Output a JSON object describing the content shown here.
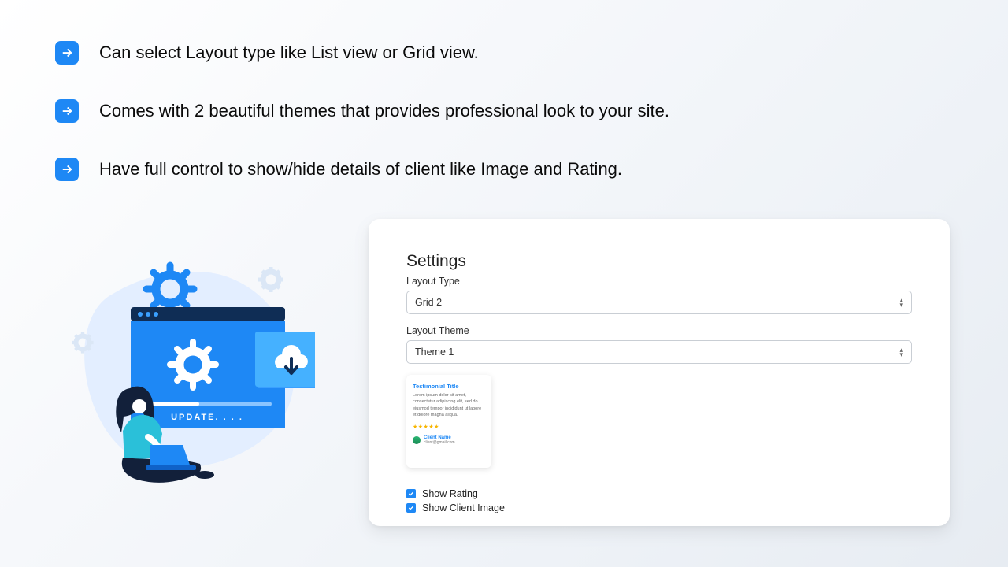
{
  "features": [
    "Can select Layout type like List view or Grid view.",
    "Comes with 2 beautiful themes that provides professional look to your site.",
    "Have full control to show/hide details of client like Image and Rating."
  ],
  "illustration": {
    "update_text": "UPDATE. . . ."
  },
  "settings": {
    "title": "Settings",
    "layout_type_label": "Layout Type",
    "layout_type_value": "Grid 2",
    "layout_theme_label": "Layout Theme",
    "layout_theme_value": "Theme 1",
    "preview": {
      "title": "Testimonial Title",
      "body": "Lorem ipsum dolor sit amet, consectetur adipiscing elit, sed do eiusmod tempor incididunt ut labore et dolore magna aliqua.",
      "stars": "★★★★★",
      "client_name": "Client Name",
      "client_email": "client@gmail.com"
    },
    "show_rating_label": "Show Rating",
    "show_client_image_label": "Show Client Image",
    "show_rating_checked": true,
    "show_client_image_checked": true
  },
  "colors": {
    "accent": "#1E88F5"
  }
}
